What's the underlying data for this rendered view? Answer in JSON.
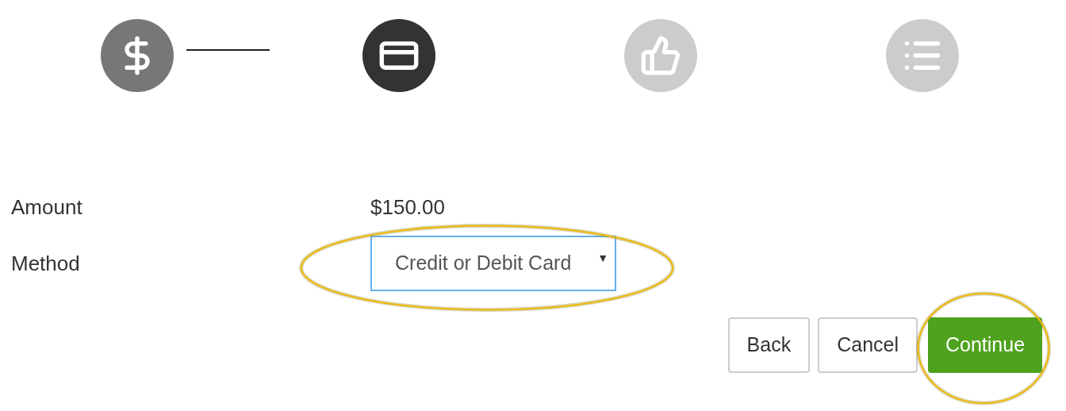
{
  "steps": [
    {
      "kind": "dollar",
      "completed": true,
      "selected": false,
      "connector": true
    },
    {
      "kind": "card",
      "completed": false,
      "selected": true,
      "connector": false
    },
    {
      "kind": "thumbs-up",
      "completed": false,
      "selected": false,
      "connector": false
    },
    {
      "kind": "list",
      "completed": false,
      "selected": false,
      "connector": false
    }
  ],
  "form": {
    "amount": {
      "label": "Amount",
      "value": "$150.00"
    },
    "method": {
      "label": "Method",
      "value": "Credit or Debit Card",
      "caret": "▼",
      "focused": true
    }
  },
  "buttons": [
    {
      "label": "Back",
      "kind": "default"
    },
    {
      "label": "Cancel",
      "kind": "default"
    },
    {
      "label": "Continue",
      "kind": "primary"
    }
  ]
}
